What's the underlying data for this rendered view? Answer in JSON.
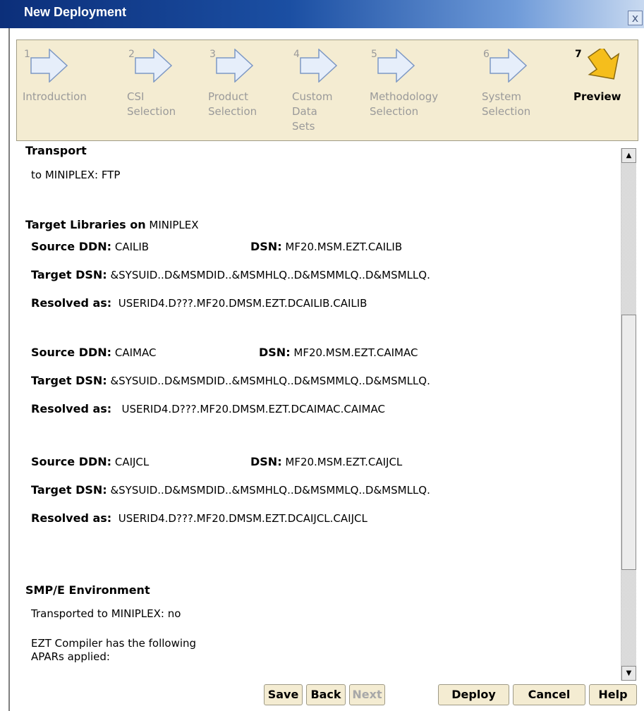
{
  "window": {
    "title": "New Deployment",
    "close_glyph": "x"
  },
  "wizard": {
    "steps": [
      {
        "num": "1",
        "label": "Introduction",
        "active": false
      },
      {
        "num": "2",
        "label": "CSI\nSelection",
        "active": false
      },
      {
        "num": "3",
        "label": "Product\nSelection",
        "active": false
      },
      {
        "num": "4",
        "label": "Custom\nData\nSets",
        "active": false
      },
      {
        "num": "5",
        "label": "Methodology\nSelection",
        "active": false
      },
      {
        "num": "6",
        "label": "System\nSelection",
        "active": false
      },
      {
        "num": "7",
        "label": "Preview",
        "active": true
      }
    ]
  },
  "transport": {
    "heading": "Transport",
    "text": "to MINIPLEX: FTP"
  },
  "target_libraries": {
    "heading_bold": "Target Libraries on",
    "heading_system": "MINIPLEX",
    "entries": [
      {
        "source_label": "Source DDN:",
        "source_value": "CAILIB",
        "dsn_label": "DSN:",
        "dsn_value": "MF20.MSM.EZT.CAILIB",
        "target_label": "Target DSN:",
        "target_value": "&SYSUID..D&MSMDID..&MSMHLQ..D&MSMMLQ..D&MSMLLQ.",
        "resolved_label": "Resolved as:",
        "resolved_value": "USERID4.D???.MF20.DMSM.EZT.DCAILIB.CAILIB"
      },
      {
        "source_label": "Source DDN:",
        "source_value": "CAIMAC",
        "dsn_label": "DSN:",
        "dsn_value": "MF20.MSM.EZT.CAIMAC",
        "target_label": "Target DSN:",
        "target_value": "&SYSUID..D&MSMDID..&MSMHLQ..D&MSMMLQ..D&MSMLLQ.",
        "resolved_label": "Resolved as:",
        "resolved_value": "USERID4.D???.MF20.DMSM.EZT.DCAIMAC.CAIMAC"
      },
      {
        "source_label": "Source DDN:",
        "source_value": "CAIJCL",
        "dsn_label": "DSN:",
        "dsn_value": "MF20.MSM.EZT.CAIJCL",
        "target_label": "Target DSN:",
        "target_value": "&SYSUID..D&MSMDID..&MSMHLQ..D&MSMMLQ..D&MSMLLQ.",
        "resolved_label": "Resolved as:",
        "resolved_value": "USERID4.D???.MF20.DMSM.EZT.DCAIJCL.CAIJCL"
      }
    ]
  },
  "smpe": {
    "heading": "SMP/E Environment",
    "transported": "Transported to MINIPLEX: no",
    "apars_line1": "EZT Compiler has the following",
    "apars_line2": "APARs applied:"
  },
  "scrollbar": {
    "up_glyph": "▲",
    "down_glyph": "▼"
  },
  "buttons": {
    "save": "Save",
    "back": "Back",
    "next": "Next",
    "deploy": "Deploy",
    "cancel": "Cancel",
    "help": "Help"
  }
}
